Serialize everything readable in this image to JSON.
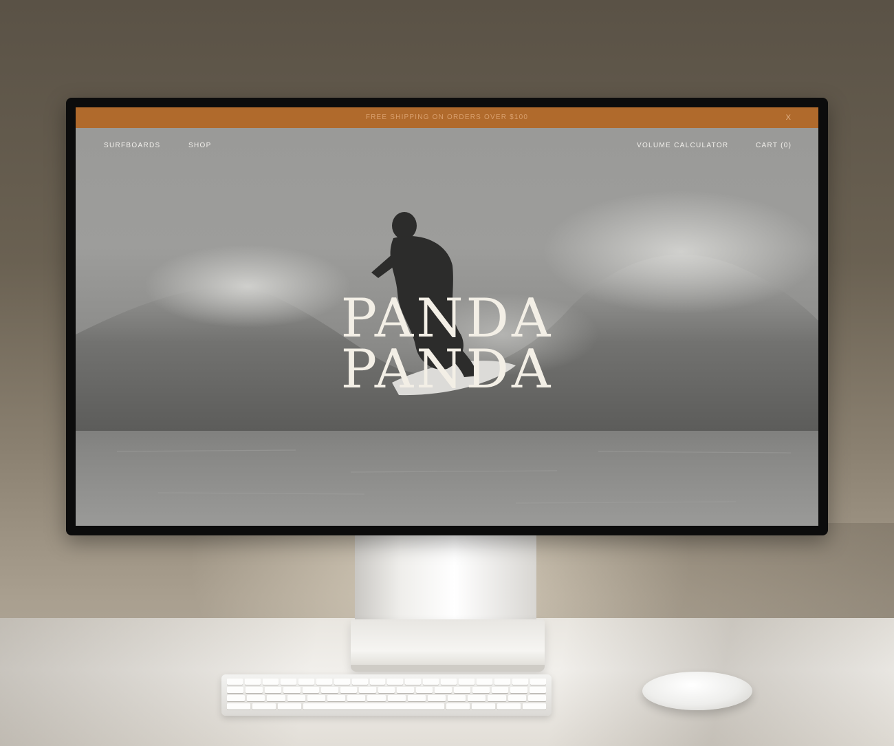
{
  "announcement": {
    "text": "FREE SHIPPING ON ORDERS OVER $100",
    "close_label": "X"
  },
  "nav": {
    "left": [
      "SURFBOARDS",
      "SHOP"
    ],
    "right": [
      "VOLUME CALCULATOR",
      "CART (0)"
    ]
  },
  "hero": {
    "logo_line_1": "PANDA",
    "logo_line_2": "PANDA"
  },
  "colors": {
    "announcement_bg": "#b06a2c",
    "logo_text": "#f3efe6",
    "nav_text": "#f2f0ec"
  }
}
